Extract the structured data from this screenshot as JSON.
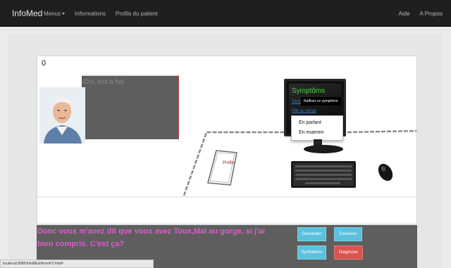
{
  "navbar": {
    "brand": "InfoMed",
    "left_items": [
      "Menus",
      "Informations",
      "Profils du patient"
    ],
    "right_items": [
      "Aide",
      "A Propos"
    ]
  },
  "game": {
    "score": "0",
    "patient_reply": "Oui, tout à fait.",
    "computer": {
      "title": "Symptôms",
      "symptoms": [
        "Toux",
        "Mal au gorge"
      ],
      "tooltip": "Raffiner ce symptôme",
      "context_menu": [
        "En parlant",
        "En examen"
      ]
    },
    "profils_label": "Profils"
  },
  "dialog": {
    "text": "Donc vous m'avez dit que vous avez Toux,Mal au gorge, si j'ai bien compris. C'est ça?"
  },
  "actions": {
    "demander": "Demander",
    "examiner": "Examiner",
    "synthetiser": "Synthétiser",
    "diagnoser": "Diagnoser"
  },
  "status_bar": "localhost:8080/InfoMEd/demoP2.html#",
  "colors": {
    "navbar": "#1f1f1f",
    "dialog_text": "#d85ec8",
    "button_info": "#5bc0de",
    "button_danger": "#d9534f",
    "symptom_title": "#49d149"
  }
}
